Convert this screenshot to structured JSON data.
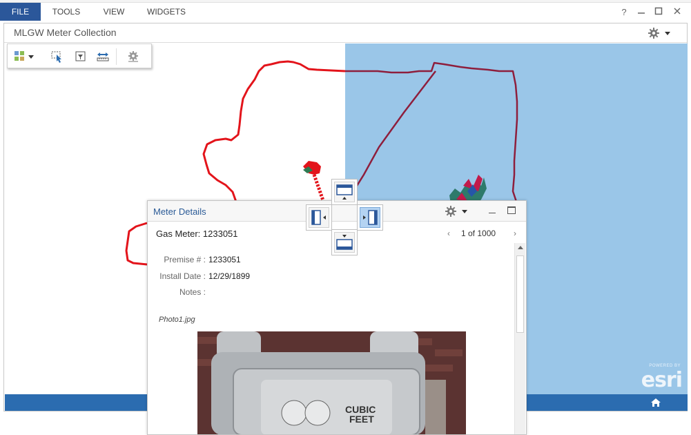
{
  "ribbon": {
    "tabs": [
      "FILE",
      "TOOLS",
      "VIEW",
      "WIDGETS"
    ],
    "help_label": "?",
    "accent_color": "#2b579a"
  },
  "app": {
    "title": "MLGW Meter Collection"
  },
  "map": {
    "water_color": "#9ac6e8",
    "boundary_color": "#e3141b",
    "toolbar_icons": [
      "basemap-gallery-icon",
      "select-icon",
      "filter-icon",
      "measure-icon",
      "settings-icon"
    ],
    "attribution": {
      "powered_by": "POWERED BY",
      "logo": "esri"
    }
  },
  "panel": {
    "title": "Meter Details",
    "feature_title": "Gas Meter: 1233051",
    "pager": {
      "prev": "‹",
      "text": "1 of 1000",
      "next": "›"
    },
    "attributes": [
      {
        "label": "Premise # :",
        "value": "1233051"
      },
      {
        "label": "Install Date :",
        "value": "12/29/1899"
      },
      {
        "label": "Notes :",
        "value": ""
      }
    ],
    "photo_label": "Photo1.jpg",
    "photo_text": {
      "line1": "CUBIC",
      "line2": "FEET"
    }
  }
}
